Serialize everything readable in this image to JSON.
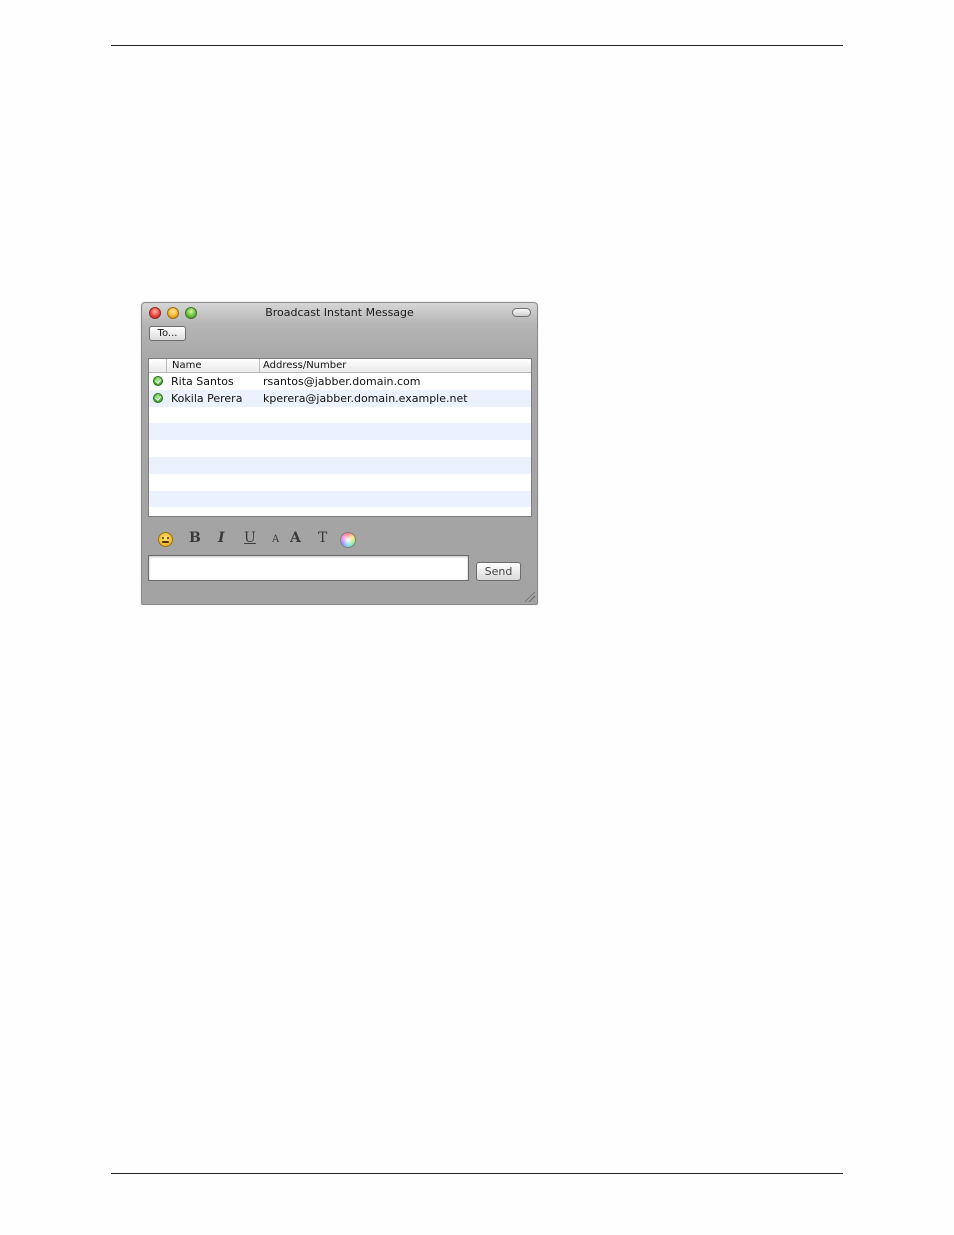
{
  "window": {
    "title": "Broadcast Instant Message"
  },
  "to_button_label": "To...",
  "list": {
    "columns": [
      "Name",
      "Address/Number"
    ],
    "rows": [
      {
        "name": "Rita Santos",
        "address": "rsantos@jabber.domain.com",
        "status": "available"
      },
      {
        "name": "Kokila Perera",
        "address": "kperera@jabber.domain.example.net",
        "status": "available"
      }
    ]
  },
  "formatting_icons": [
    "smiley-icon",
    "bold-icon",
    "italic-icon",
    "underline-icon",
    "font-size-decrease-icon",
    "font-size-increase-icon",
    "font-face-icon",
    "color-wheel-icon"
  ],
  "format_labels": {
    "bold": "B",
    "italic": "I",
    "underline": "U",
    "small_a": "A",
    "large_a": "A",
    "font": "T"
  },
  "message_input": {
    "value": "",
    "placeholder": ""
  },
  "send_button_label": "Send",
  "colors": {
    "window_bg": "#a7a7a7",
    "list_alt_row": "#ecf2fd",
    "status_available": "#4fb33a"
  }
}
